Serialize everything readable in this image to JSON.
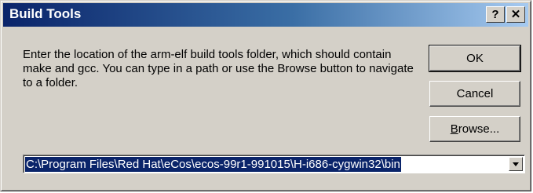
{
  "window": {
    "title": "Build Tools",
    "help_glyph": "?",
    "close_glyph": "✕"
  },
  "message": "Enter the location of the arm-elf build tools folder, which should contain make and gcc.  You can type in a path or use the Browse button to navigate to a folder.",
  "buttons": {
    "ok_label": "OK",
    "cancel_label": "Cancel",
    "browse_label_prefix": "",
    "browse_mnemonic": "B",
    "browse_label_rest": "rowse..."
  },
  "path_combo": {
    "value": "C:\\Program Files\\Red Hat\\eCos\\ecos-99r1-991015\\H-i686-cygwin32\\bin"
  },
  "colors": {
    "title_active": "#0a246a",
    "face": "#d4d0c8",
    "selection": "#0a246a"
  }
}
